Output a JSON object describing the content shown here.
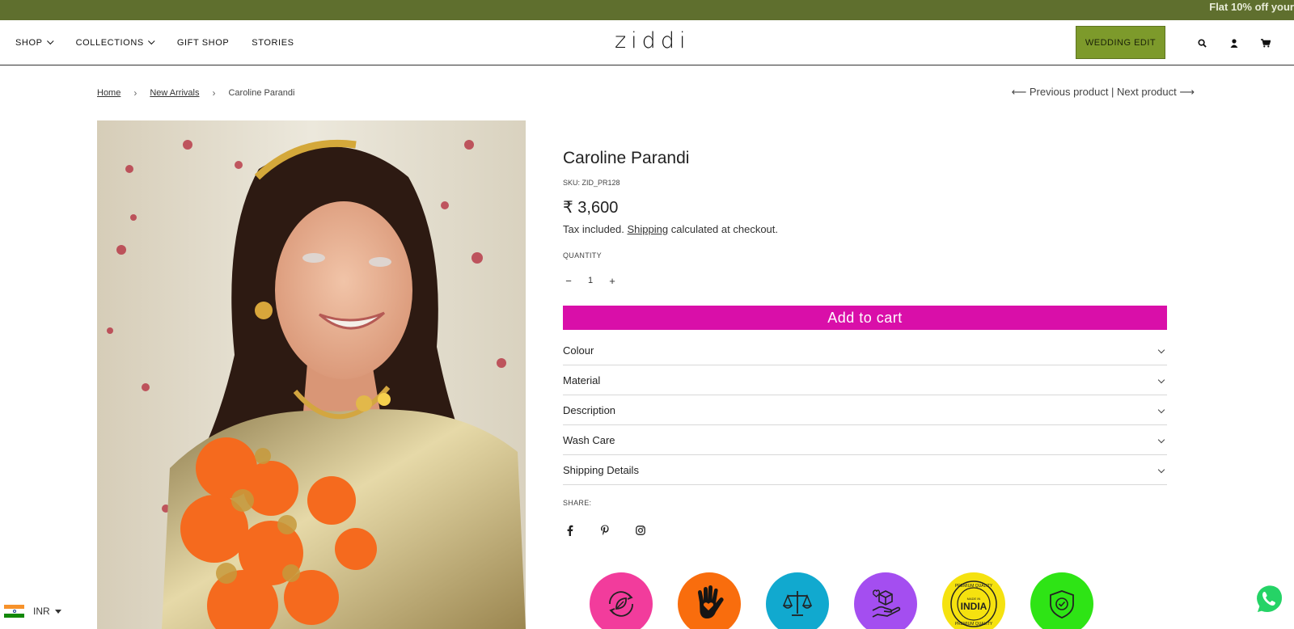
{
  "announcement": {
    "text": "Flat 10% off your"
  },
  "header": {
    "logo": "ziddi",
    "nav": [
      {
        "label": "SHOP",
        "has_dropdown": true
      },
      {
        "label": "COLLECTIONS",
        "has_dropdown": true
      },
      {
        "label": "GIFT SHOP",
        "has_dropdown": false
      },
      {
        "label": "STORIES",
        "has_dropdown": false
      }
    ],
    "cta_label": "WEDDING EDIT",
    "icons": [
      "search-icon",
      "account-icon",
      "cart-icon"
    ]
  },
  "breadcrumb": {
    "items": [
      {
        "label": "Home"
      },
      {
        "label": "New Arrivals"
      },
      {
        "label": "Caroline Parandi"
      }
    ],
    "separator": "›"
  },
  "pager": {
    "prev_label": "⟵ Previous product",
    "divider": " | ",
    "next_label": "Next product ⟶"
  },
  "product": {
    "title": "Caroline Parandi",
    "sku": "SKU: ZID_PR128",
    "price": "₹ 3,600",
    "tax_prefix": "Tax included.",
    "tax_link": "Shipping",
    "tax_suffix": "calculated at checkout.",
    "quantity_label": "QUANTITY",
    "quantity_value": "1",
    "qty_minus": "−",
    "qty_plus": "+",
    "add_to_cart": "Add to cart",
    "accordion": [
      "Colour",
      "Material",
      "Description",
      "Wash Care",
      "Shipping Details"
    ],
    "share_label": "SHARE:",
    "share_icons": [
      "facebook-icon",
      "pinterest-icon",
      "instagram-icon"
    ]
  },
  "badges": [
    {
      "name": "sustainable-badge",
      "color": "#f23c9c"
    },
    {
      "name": "handmade-badge",
      "color": "#f96d0d"
    },
    {
      "name": "fair-trade-badge",
      "color": "#11a9cf"
    },
    {
      "name": "care-package-badge",
      "color": "#a44ef0"
    },
    {
      "name": "made-in-india-badge",
      "color": "#f5e20f",
      "text_top": "PREMIUM QUALITY",
      "text_mid": "INDIA",
      "text_small": "MADE IN"
    },
    {
      "name": "secure-badge",
      "color": "#2ee415"
    }
  ],
  "currency": {
    "code": "INR",
    "flag_colors": [
      "#f6922b",
      "#ffffff",
      "#128807"
    ]
  },
  "colors": {
    "announcement_bg": "#5f6f2e",
    "cta_bg": "#7d9a2b",
    "add_to_cart_bg": "#d90fa9",
    "whatsapp": "#25d366"
  }
}
